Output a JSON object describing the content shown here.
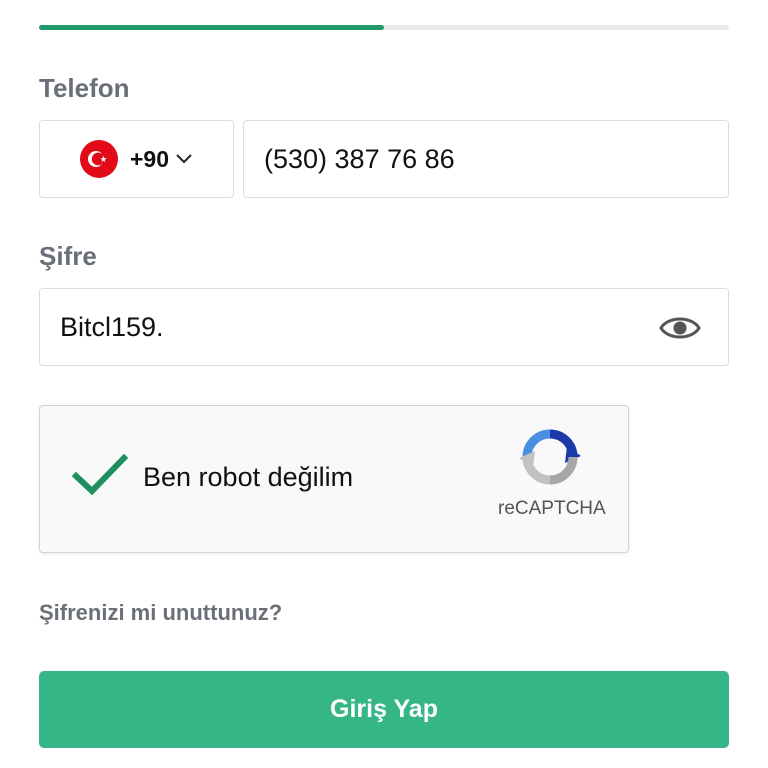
{
  "progress": {
    "fraction": 0.5,
    "fill_color": "#1f9a6a",
    "track_color": "#ebebeb"
  },
  "phone": {
    "label": "Telefon",
    "country": {
      "flag_icon": "turkey-flag-icon",
      "dial_code": "+90"
    },
    "number_value": "(530) 387 76 86"
  },
  "password": {
    "label": "Şifre",
    "value": "Bitcl159.",
    "toggle_icon": "eye-icon"
  },
  "captcha": {
    "text": "Ben robot değilim",
    "checked": true,
    "brand": "reCAPTCHA",
    "check_color": "#1f8f5f"
  },
  "forgot_link": "Şifrenizi mi unuttunuz?",
  "login_button": {
    "label": "Giriş Yap",
    "color": "#36b587"
  }
}
